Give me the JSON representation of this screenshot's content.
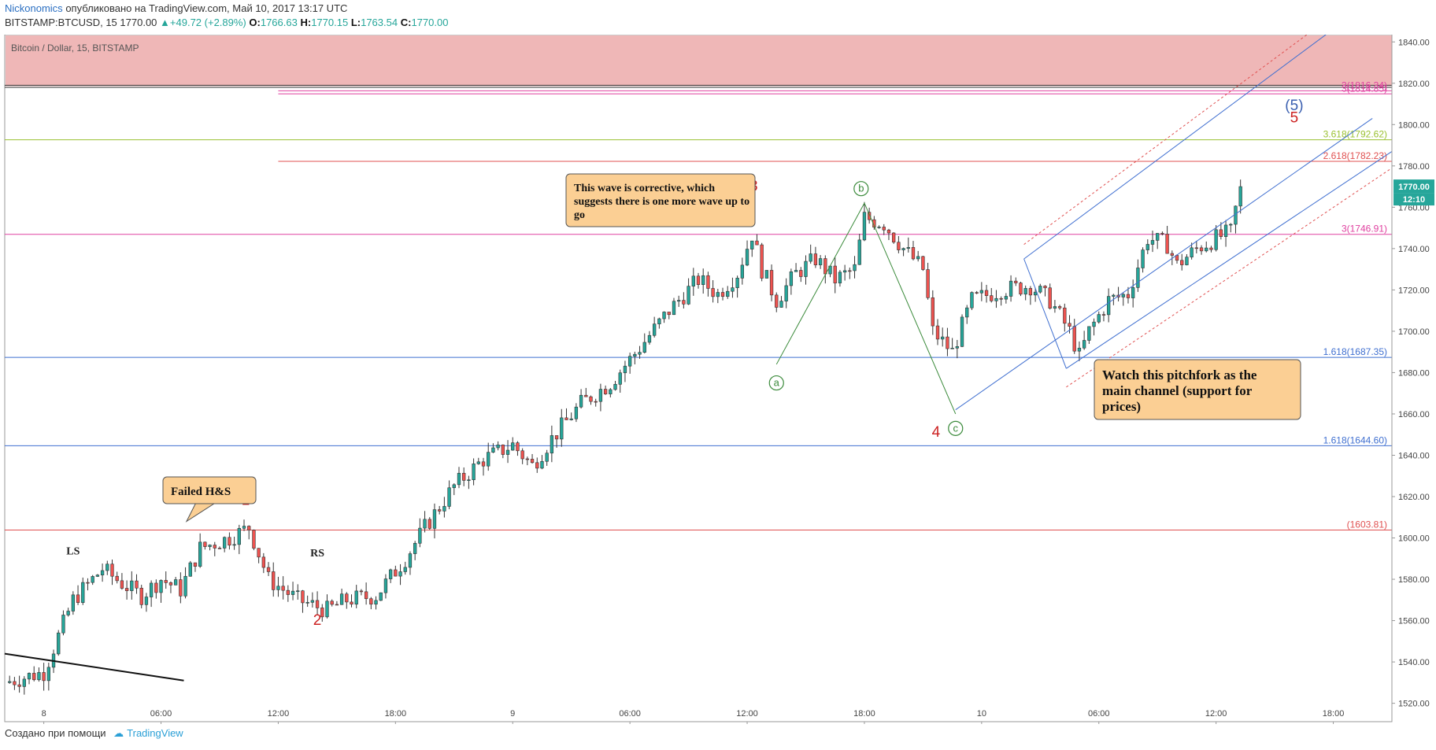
{
  "header": {
    "author": "Nickonomics",
    "published": "опубликовано на TradingView.com, Май 10, 2017 13:17 UTC",
    "symbol": "BITSTAMP:BTCUSD, 15",
    "last": "1770.00",
    "change": "▲+49.72 (+2.89%)",
    "o_label": "O:",
    "o_val": "1766.63",
    "h_label": "H:",
    "h_val": "1770.15",
    "l_label": "L:",
    "l_val": "1763.54",
    "c_label": "C:",
    "c_val": "1770.00"
  },
  "footer": {
    "created": "Создано при помощи",
    "brand": "TradingView"
  },
  "colors": {
    "up": "#26a69a",
    "down": "#ef5350",
    "zone": "#eeb3b3",
    "blue": "#3f6fd0",
    "red": "#e05050",
    "pink": "#e040a0",
    "olive": "#9ac030",
    "wave_green": "#3a8a3a"
  },
  "chart_data": {
    "type": "candlestick",
    "title": "Bitcoin / Dollar, 15, BITSTAMP",
    "ylim": [
      1513,
      1842
    ],
    "y_ticks": [
      1520,
      1540,
      1560,
      1580,
      1600,
      1620,
      1640,
      1660,
      1680,
      1700,
      1720,
      1740,
      1760,
      1780,
      1800,
      1820,
      1840
    ],
    "x_range": [
      "2017-05-07 22:00",
      "2017-05-10 21:00"
    ],
    "x_ticks": [
      {
        "t": "2017-05-08 00:00",
        "label": "8"
      },
      {
        "t": "2017-05-08 06:00",
        "label": "06:00"
      },
      {
        "t": "2017-05-08 12:00",
        "label": "12:00"
      },
      {
        "t": "2017-05-08 18:00",
        "label": "18:00"
      },
      {
        "t": "2017-05-09 00:00",
        "label": "9"
      },
      {
        "t": "2017-05-09 06:00",
        "label": "06:00"
      },
      {
        "t": "2017-05-09 12:00",
        "label": "12:00"
      },
      {
        "t": "2017-05-09 18:00",
        "label": "18:00"
      },
      {
        "t": "2017-05-10 00:00",
        "label": "10"
      },
      {
        "t": "2017-05-10 06:00",
        "label": "06:00"
      },
      {
        "t": "2017-05-10 12:00",
        "label": "12:00"
      },
      {
        "t": "2017-05-10 18:00",
        "label": "18:00"
      }
    ],
    "price_path": [
      [
        "2017-05-07 22:00",
        1530
      ],
      [
        "2017-05-08 00:00",
        1535
      ],
      [
        "2017-05-08 01:30",
        1570
      ],
      [
        "2017-05-08 03:00",
        1585
      ],
      [
        "2017-05-08 04:00",
        1578
      ],
      [
        "2017-05-08 05:00",
        1572
      ],
      [
        "2017-05-08 06:00",
        1580
      ],
      [
        "2017-05-08 07:00",
        1575
      ],
      [
        "2017-05-08 08:00",
        1595
      ],
      [
        "2017-05-08 09:30",
        1600
      ],
      [
        "2017-05-08 10:30",
        1605
      ],
      [
        "2017-05-08 11:30",
        1580
      ],
      [
        "2017-05-08 13:00",
        1570
      ],
      [
        "2017-05-08 14:30",
        1565
      ],
      [
        "2017-05-08 15:30",
        1570
      ],
      [
        "2017-05-08 17:00",
        1572
      ],
      [
        "2017-05-08 18:30",
        1590
      ],
      [
        "2017-05-08 19:30",
        1605
      ],
      [
        "2017-05-08 21:00",
        1625
      ],
      [
        "2017-05-08 22:30",
        1638
      ],
      [
        "2017-05-09 00:00",
        1645
      ],
      [
        "2017-05-09 01:00",
        1635
      ],
      [
        "2017-05-09 02:00",
        1648
      ],
      [
        "2017-05-09 03:30",
        1665
      ],
      [
        "2017-05-09 05:00",
        1675
      ],
      [
        "2017-05-09 06:30",
        1692
      ],
      [
        "2017-05-09 08:00",
        1710
      ],
      [
        "2017-05-09 09:30",
        1725
      ],
      [
        "2017-05-09 10:30",
        1718
      ],
      [
        "2017-05-09 11:30",
        1728
      ],
      [
        "2017-05-09 12:15",
        1747
      ],
      [
        "2017-05-09 12:45",
        1730
      ],
      [
        "2017-05-09 13:30",
        1715
      ],
      [
        "2017-05-09 14:30",
        1728
      ],
      [
        "2017-05-09 15:30",
        1735
      ],
      [
        "2017-05-09 16:30",
        1725
      ],
      [
        "2017-05-09 17:30",
        1730
      ],
      [
        "2017-05-09 18:00",
        1755
      ],
      [
        "2017-05-09 19:00",
        1752
      ],
      [
        "2017-05-09 20:00",
        1740
      ],
      [
        "2017-05-09 21:00",
        1730
      ],
      [
        "2017-05-09 21:30",
        1700
      ],
      [
        "2017-05-09 22:30",
        1690
      ],
      [
        "2017-05-09 23:30",
        1715
      ],
      [
        "2017-05-10 01:00",
        1720
      ],
      [
        "2017-05-10 02:30",
        1722
      ],
      [
        "2017-05-10 03:30",
        1715
      ],
      [
        "2017-05-10 04:30",
        1700
      ],
      [
        "2017-05-10 05:00",
        1688
      ],
      [
        "2017-05-10 05:30",
        1700
      ],
      [
        "2017-05-10 06:30",
        1715
      ],
      [
        "2017-05-10 07:30",
        1718
      ],
      [
        "2017-05-10 08:30",
        1745
      ],
      [
        "2017-05-10 09:30",
        1742
      ],
      [
        "2017-05-10 10:00",
        1732
      ],
      [
        "2017-05-10 11:00",
        1740
      ],
      [
        "2017-05-10 12:00",
        1745
      ],
      [
        "2017-05-10 12:45",
        1748
      ],
      [
        "2017-05-10 13:15",
        1770
      ]
    ],
    "horizontal_levels": [
      {
        "price": 1814.85,
        "label": "3(1814.85)",
        "color": "#e040a0",
        "start": "2017-05-08 12:00"
      },
      {
        "price": 1816.34,
        "label": "3(1816.34)",
        "color": "#e040a0",
        "start": "2017-05-08 12:00"
      },
      {
        "price": 1792.62,
        "label": "3.618(1792.62)",
        "color": "#9ac030",
        "start": "2017-05-07 22:00"
      },
      {
        "price": 1782.23,
        "label": "2.618(1782.23)",
        "color": "#e05050",
        "start": "2017-05-08 12:00"
      },
      {
        "price": 1746.91,
        "label": "3(1746.91)",
        "color": "#e040a0",
        "start": "2017-05-07 22:00"
      },
      {
        "price": 1687.35,
        "label": "1.618(1687.35)",
        "color": "#3f6fd0",
        "start": "2017-05-07 22:00"
      },
      {
        "price": 1644.6,
        "label": "1.618(1644.60)",
        "color": "#3f6fd0",
        "start": "2017-05-07 22:00"
      },
      {
        "price": 1603.81,
        "label": "(1603.81)",
        "color": "#e05050",
        "start": "2017-05-07 22:00"
      }
    ],
    "current_price": {
      "value": "1770.00",
      "countdown": "12:10"
    },
    "wave_labels": [
      {
        "text": "1",
        "t": "2017-05-08 10:20",
        "price": 1616,
        "color": "#cc2222"
      },
      {
        "text": "2",
        "t": "2017-05-08 14:00",
        "price": 1558,
        "color": "#cc2222"
      },
      {
        "text": "3",
        "t": "2017-05-09 12:20",
        "price": 1768,
        "color": "#cc2222"
      },
      {
        "text": "4",
        "t": "2017-05-09 21:40",
        "price": 1649,
        "color": "#cc2222"
      },
      {
        "text": "5",
        "t": "2017-05-10 16:00",
        "price": 1801,
        "color": "#cc2222"
      },
      {
        "text": "(5)",
        "t": "2017-05-10 16:00",
        "price": 1807,
        "color": "#3a5fb0"
      },
      {
        "text": "LS",
        "t": "2017-05-08 01:30",
        "price": 1592,
        "color": "#222222"
      },
      {
        "text": "RS",
        "t": "2017-05-08 14:00",
        "price": 1591,
        "color": "#222222"
      }
    ],
    "abc_path": [
      [
        "2017-05-09 13:30",
        1684
      ],
      [
        "2017-05-09 18:00",
        1762
      ],
      [
        "2017-05-09 22:40",
        1660
      ]
    ],
    "abc_labels": [
      {
        "text": "a",
        "t": "2017-05-09 13:30",
        "price": 1675
      },
      {
        "text": "b",
        "t": "2017-05-09 17:50",
        "price": 1769
      },
      {
        "text": "c",
        "t": "2017-05-09 22:40",
        "price": 1653
      }
    ],
    "trendline": [
      [
        "2017-05-07 22:00",
        1544
      ],
      [
        "2017-05-08 07:10",
        1531
      ]
    ],
    "pitchfork": {
      "median": [
        [
          "2017-05-09 22:40",
          1662
        ],
        [
          "2017-05-10 20:00",
          1803
        ]
      ],
      "upper": [
        [
          "2017-05-10 02:10",
          1735
        ],
        [
          "2017-05-10 17:50",
          1845
        ]
      ],
      "lower": [
        [
          "2017-05-10 04:20",
          1682
        ],
        [
          "2017-05-10 21:00",
          1787
        ]
      ],
      "upper_warn": [
        [
          "2017-05-10 02:10",
          1742
        ],
        [
          "2017-05-10 21:00",
          1874
        ]
      ],
      "lower_warn": [
        [
          "2017-05-10 04:20",
          1673
        ],
        [
          "2017-05-10 21:00",
          1779
        ]
      ]
    },
    "callouts": [
      {
        "text": "Failed H&S",
        "t": "2017-05-08 06:30",
        "price": 1608
      },
      {
        "text": "This wave is corrective, which suggests there is one more wave up to go",
        "t": "2017-05-09 12:05",
        "price": 1760
      },
      {
        "text": "Watch this pitchfork as the main channel (support for prices)",
        "t": "2017-05-10 04:40",
        "price": 1675
      }
    ]
  }
}
